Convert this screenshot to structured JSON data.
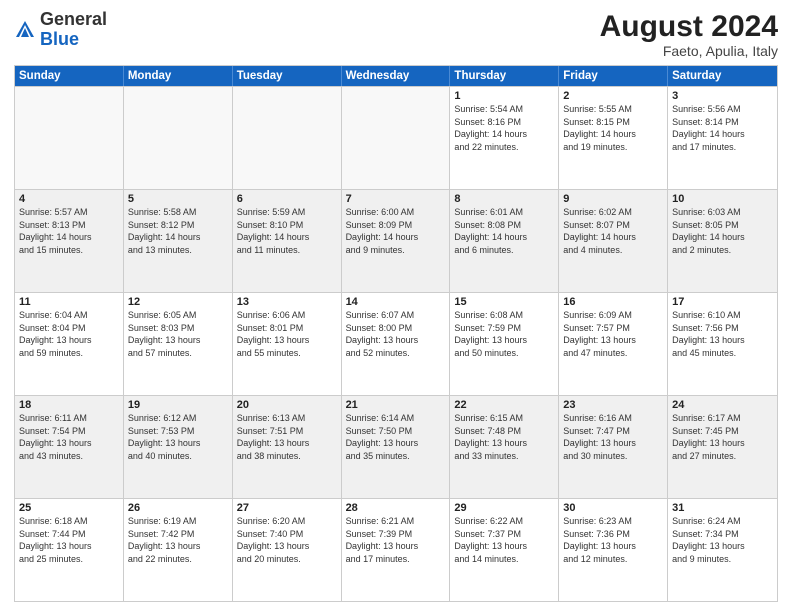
{
  "logo": {
    "general": "General",
    "blue": "Blue"
  },
  "title": {
    "month_year": "August 2024",
    "location": "Faeto, Apulia, Italy"
  },
  "days_of_week": [
    "Sunday",
    "Monday",
    "Tuesday",
    "Wednesday",
    "Thursday",
    "Friday",
    "Saturday"
  ],
  "weeks": [
    [
      {
        "day": "",
        "lines": [],
        "empty": true
      },
      {
        "day": "",
        "lines": [],
        "empty": true
      },
      {
        "day": "",
        "lines": [],
        "empty": true
      },
      {
        "day": "",
        "lines": [],
        "empty": true
      },
      {
        "day": "1",
        "lines": [
          "Sunrise: 5:54 AM",
          "Sunset: 8:16 PM",
          "Daylight: 14 hours",
          "and 22 minutes."
        ]
      },
      {
        "day": "2",
        "lines": [
          "Sunrise: 5:55 AM",
          "Sunset: 8:15 PM",
          "Daylight: 14 hours",
          "and 19 minutes."
        ]
      },
      {
        "day": "3",
        "lines": [
          "Sunrise: 5:56 AM",
          "Sunset: 8:14 PM",
          "Daylight: 14 hours",
          "and 17 minutes."
        ]
      }
    ],
    [
      {
        "day": "4",
        "lines": [
          "Sunrise: 5:57 AM",
          "Sunset: 8:13 PM",
          "Daylight: 14 hours",
          "and 15 minutes."
        ],
        "shaded": true
      },
      {
        "day": "5",
        "lines": [
          "Sunrise: 5:58 AM",
          "Sunset: 8:12 PM",
          "Daylight: 14 hours",
          "and 13 minutes."
        ],
        "shaded": true
      },
      {
        "day": "6",
        "lines": [
          "Sunrise: 5:59 AM",
          "Sunset: 8:10 PM",
          "Daylight: 14 hours",
          "and 11 minutes."
        ],
        "shaded": true
      },
      {
        "day": "7",
        "lines": [
          "Sunrise: 6:00 AM",
          "Sunset: 8:09 PM",
          "Daylight: 14 hours",
          "and 9 minutes."
        ],
        "shaded": true
      },
      {
        "day": "8",
        "lines": [
          "Sunrise: 6:01 AM",
          "Sunset: 8:08 PM",
          "Daylight: 14 hours",
          "and 6 minutes."
        ],
        "shaded": true
      },
      {
        "day": "9",
        "lines": [
          "Sunrise: 6:02 AM",
          "Sunset: 8:07 PM",
          "Daylight: 14 hours",
          "and 4 minutes."
        ],
        "shaded": true
      },
      {
        "day": "10",
        "lines": [
          "Sunrise: 6:03 AM",
          "Sunset: 8:05 PM",
          "Daylight: 14 hours",
          "and 2 minutes."
        ],
        "shaded": true
      }
    ],
    [
      {
        "day": "11",
        "lines": [
          "Sunrise: 6:04 AM",
          "Sunset: 8:04 PM",
          "Daylight: 13 hours",
          "and 59 minutes."
        ]
      },
      {
        "day": "12",
        "lines": [
          "Sunrise: 6:05 AM",
          "Sunset: 8:03 PM",
          "Daylight: 13 hours",
          "and 57 minutes."
        ]
      },
      {
        "day": "13",
        "lines": [
          "Sunrise: 6:06 AM",
          "Sunset: 8:01 PM",
          "Daylight: 13 hours",
          "and 55 minutes."
        ]
      },
      {
        "day": "14",
        "lines": [
          "Sunrise: 6:07 AM",
          "Sunset: 8:00 PM",
          "Daylight: 13 hours",
          "and 52 minutes."
        ]
      },
      {
        "day": "15",
        "lines": [
          "Sunrise: 6:08 AM",
          "Sunset: 7:59 PM",
          "Daylight: 13 hours",
          "and 50 minutes."
        ]
      },
      {
        "day": "16",
        "lines": [
          "Sunrise: 6:09 AM",
          "Sunset: 7:57 PM",
          "Daylight: 13 hours",
          "and 47 minutes."
        ]
      },
      {
        "day": "17",
        "lines": [
          "Sunrise: 6:10 AM",
          "Sunset: 7:56 PM",
          "Daylight: 13 hours",
          "and 45 minutes."
        ]
      }
    ],
    [
      {
        "day": "18",
        "lines": [
          "Sunrise: 6:11 AM",
          "Sunset: 7:54 PM",
          "Daylight: 13 hours",
          "and 43 minutes."
        ],
        "shaded": true
      },
      {
        "day": "19",
        "lines": [
          "Sunrise: 6:12 AM",
          "Sunset: 7:53 PM",
          "Daylight: 13 hours",
          "and 40 minutes."
        ],
        "shaded": true
      },
      {
        "day": "20",
        "lines": [
          "Sunrise: 6:13 AM",
          "Sunset: 7:51 PM",
          "Daylight: 13 hours",
          "and 38 minutes."
        ],
        "shaded": true
      },
      {
        "day": "21",
        "lines": [
          "Sunrise: 6:14 AM",
          "Sunset: 7:50 PM",
          "Daylight: 13 hours",
          "and 35 minutes."
        ],
        "shaded": true
      },
      {
        "day": "22",
        "lines": [
          "Sunrise: 6:15 AM",
          "Sunset: 7:48 PM",
          "Daylight: 13 hours",
          "and 33 minutes."
        ],
        "shaded": true
      },
      {
        "day": "23",
        "lines": [
          "Sunrise: 6:16 AM",
          "Sunset: 7:47 PM",
          "Daylight: 13 hours",
          "and 30 minutes."
        ],
        "shaded": true
      },
      {
        "day": "24",
        "lines": [
          "Sunrise: 6:17 AM",
          "Sunset: 7:45 PM",
          "Daylight: 13 hours",
          "and 27 minutes."
        ],
        "shaded": true
      }
    ],
    [
      {
        "day": "25",
        "lines": [
          "Sunrise: 6:18 AM",
          "Sunset: 7:44 PM",
          "Daylight: 13 hours",
          "and 25 minutes."
        ]
      },
      {
        "day": "26",
        "lines": [
          "Sunrise: 6:19 AM",
          "Sunset: 7:42 PM",
          "Daylight: 13 hours",
          "and 22 minutes."
        ]
      },
      {
        "day": "27",
        "lines": [
          "Sunrise: 6:20 AM",
          "Sunset: 7:40 PM",
          "Daylight: 13 hours",
          "and 20 minutes."
        ]
      },
      {
        "day": "28",
        "lines": [
          "Sunrise: 6:21 AM",
          "Sunset: 7:39 PM",
          "Daylight: 13 hours",
          "and 17 minutes."
        ]
      },
      {
        "day": "29",
        "lines": [
          "Sunrise: 6:22 AM",
          "Sunset: 7:37 PM",
          "Daylight: 13 hours",
          "and 14 minutes."
        ]
      },
      {
        "day": "30",
        "lines": [
          "Sunrise: 6:23 AM",
          "Sunset: 7:36 PM",
          "Daylight: 13 hours",
          "and 12 minutes."
        ]
      },
      {
        "day": "31",
        "lines": [
          "Sunrise: 6:24 AM",
          "Sunset: 7:34 PM",
          "Daylight: 13 hours",
          "and 9 minutes."
        ]
      }
    ]
  ]
}
